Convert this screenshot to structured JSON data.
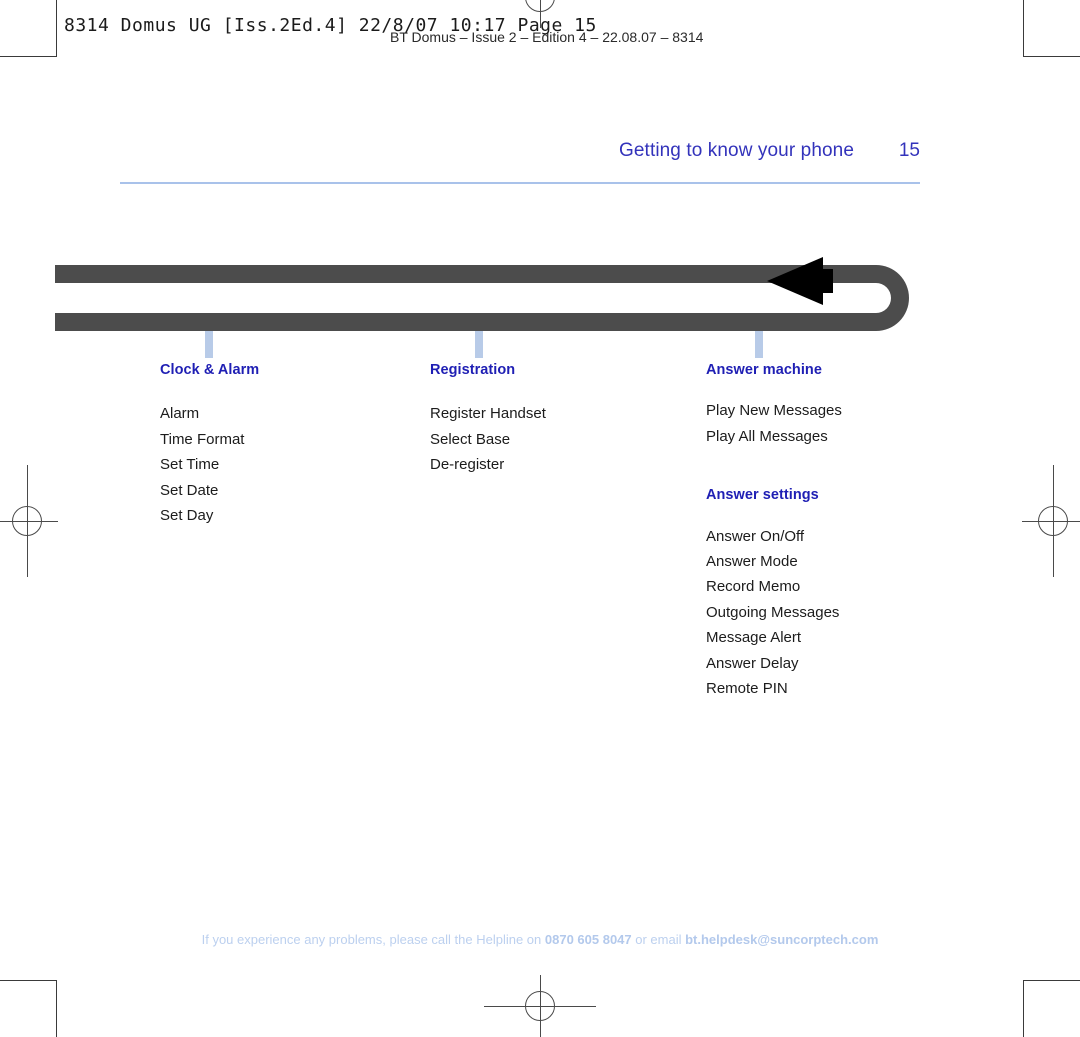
{
  "prepress": {
    "slug_line_mono": "8314 Domus UG [Iss.2Ed.4]  22/8/07  10:17  Page 15",
    "slug_line_sans": "BT Domus – Issue 2 – Edition 4 – 22.08.07 – 8314"
  },
  "header": {
    "title": "Getting to know your phone",
    "page_number": "15"
  },
  "diagram": {
    "arrow_direction": "left",
    "track_color": "#4c4c4c",
    "arrow_color": "#000000",
    "tick_color": "#b8cbe8",
    "tick_positions": [
      150,
      420,
      700
    ]
  },
  "columns": [
    {
      "groups": [
        {
          "heading": "Clock & Alarm",
          "items": [
            "Alarm",
            "Time Format",
            "Set Time",
            "Set Date",
            "Set Day"
          ]
        }
      ]
    },
    {
      "groups": [
        {
          "heading": "Registration",
          "items": [
            "Register Handset",
            "Select Base",
            "De-register"
          ]
        }
      ]
    },
    {
      "groups": [
        {
          "heading": "Answer machine",
          "items": [
            "Play New Messages",
            "Play All Messages"
          ]
        },
        {
          "heading": "Answer settings",
          "items": [
            "Answer On/Off",
            "Answer Mode",
            "Record Memo",
            "Outgoing Messages",
            "Message Alert",
            "Answer Delay",
            "Remote PIN"
          ]
        }
      ]
    }
  ],
  "footer": {
    "text_before": "If you experience any problems, please call the Helpline on ",
    "phone": "0870 605 8047",
    "text_middle": " or email ",
    "email": "bt.helpdesk@suncorptech.com"
  },
  "colors": {
    "heading_blue": "#1f1fb4",
    "header_blue": "#3333bb",
    "rule_blue": "#a9c2ea",
    "footer_blue": "#bcd0ef"
  }
}
